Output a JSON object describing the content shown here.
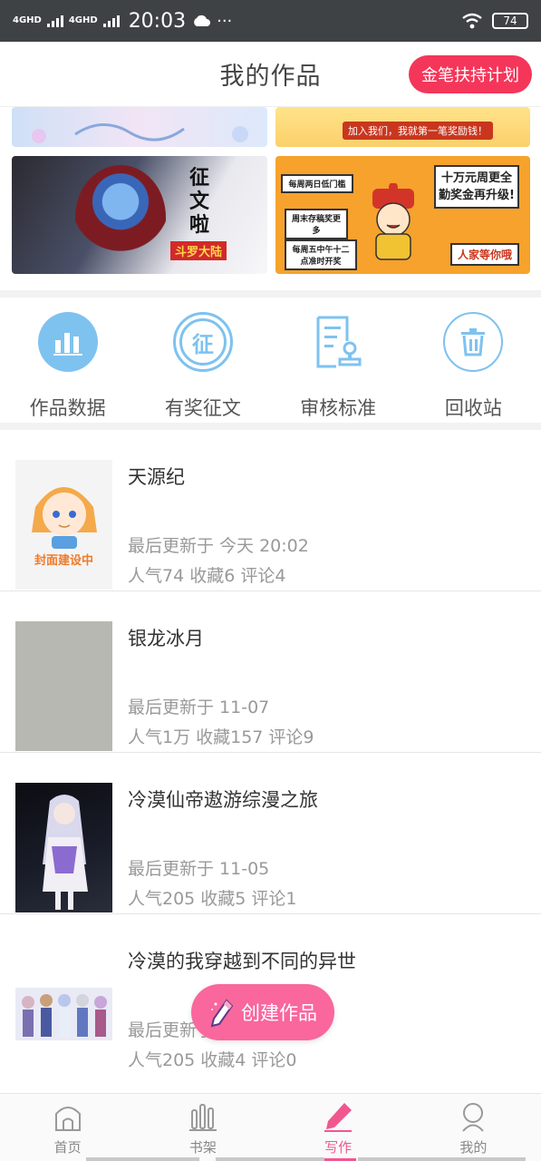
{
  "status_bar": {
    "signal1": "4GHD",
    "signal2": "4GHD",
    "time": "20:03",
    "more": "···",
    "battery": "74"
  },
  "header": {
    "title": "我的作品",
    "plan_button": "金笔扶持计划"
  },
  "banners": [
    {
      "name": "top-left-banner"
    },
    {
      "name": "top-right-banner",
      "tag": "加入我们，我就第一笔奖励钱！"
    },
    {
      "name": "contest-banner",
      "heading": "征文啦",
      "subtitle": "斗罗大陆"
    },
    {
      "name": "bonus-banner",
      "boxes": [
        "每周两日低门槛",
        "周末存稿奖更多",
        "每周五中午十二点准时开奖"
      ],
      "headline": "十万元周更全勤奖金再升级!",
      "cta": "人家等你哦"
    }
  ],
  "quick_actions": [
    {
      "label": "作品数据",
      "icon": "bar-chart-icon"
    },
    {
      "label": "有奖征文",
      "icon": "contest-icon",
      "glyph": "征"
    },
    {
      "label": "审核标准",
      "icon": "review-doc-icon"
    },
    {
      "label": "回收站",
      "icon": "trash-icon"
    }
  ],
  "works": [
    {
      "title": "天源纪",
      "updated": "最后更新于 今天 20:02",
      "stats": "人气74 收藏6 评论4",
      "cover_caption": "封面建设中"
    },
    {
      "title": "银龙冰月",
      "updated": "最后更新于 11-07",
      "stats": "人气1万 收藏157 评论9"
    },
    {
      "title": "冷漠仙帝遨游综漫之旅",
      "updated": "最后更新于 11-05",
      "stats": "人气205 收藏5 评论1"
    },
    {
      "title": "冷漠的我穿越到不同的异世",
      "updated": "最后更新于",
      "stats": "人气205 收藏4 评论0"
    }
  ],
  "fab": {
    "label": "创建作品"
  },
  "tabs": [
    {
      "label": "首页",
      "icon": "home-icon"
    },
    {
      "label": "书架",
      "icon": "bookshelf-icon"
    },
    {
      "label": "写作",
      "icon": "pen-icon",
      "active": true
    },
    {
      "label": "我的",
      "icon": "profile-icon"
    }
  ],
  "colors": {
    "accent": "#f4365a",
    "pink": "#f9679c",
    "icon_blue": "#7ec2f0"
  }
}
